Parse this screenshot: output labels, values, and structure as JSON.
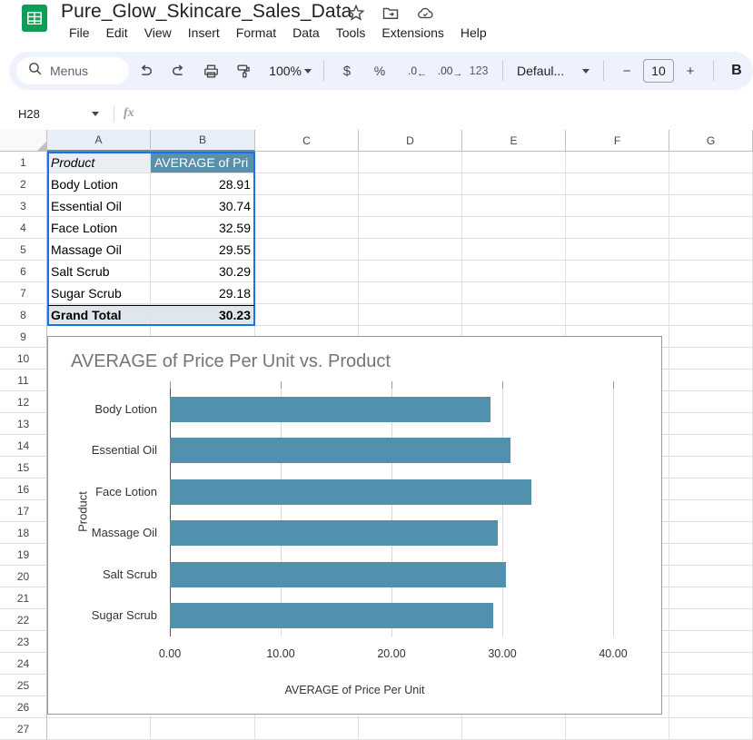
{
  "app": {
    "logo_icon": "sheets-logo-icon",
    "doc_title": "Pure_Glow_Skincare_Sales_Data",
    "title_icons": [
      {
        "name": "star-icon",
        "label": "Star"
      },
      {
        "name": "move-to-folder-icon",
        "label": "Move"
      },
      {
        "name": "cloud-saved-icon",
        "label": "Saved to Drive"
      }
    ],
    "menus": [
      "File",
      "Edit",
      "View",
      "Insert",
      "Format",
      "Data",
      "Tools",
      "Extensions",
      "Help"
    ]
  },
  "toolbar": {
    "search_icon": "search-icon",
    "search_label": "Menus",
    "undo_icon": "undo-icon",
    "redo_icon": "redo-icon",
    "print_icon": "print-icon",
    "paint_format_icon": "paint-format-icon",
    "zoom_value": "100%",
    "currency_label": "$",
    "percent_label": "%",
    "decrease_decimal_label": ".0",
    "increase_decimal_label": ".00",
    "more_formats_label": "123",
    "font_name": "Defaul...",
    "font_size": "10",
    "minus_label": "−",
    "plus_label": "+",
    "bold_label": "B"
  },
  "formula_bar": {
    "name_box": "H28",
    "fx_label": "fx",
    "formula_value": ""
  },
  "grid": {
    "columns": [
      "A",
      "B",
      "C",
      "D",
      "E",
      "F",
      "G"
    ],
    "rows": [
      1,
      2,
      3,
      4,
      5,
      6,
      7,
      8,
      9,
      10,
      11,
      12,
      13,
      14,
      15,
      16,
      17,
      18,
      19,
      20,
      21,
      22,
      23,
      24,
      25,
      26,
      27
    ],
    "data": [
      {
        "a": "Product",
        "b": "AVERAGE of Pri"
      },
      {
        "a": "Body Lotion",
        "b": "28.91"
      },
      {
        "a": "Essential Oil",
        "b": "30.74"
      },
      {
        "a": "Face Lotion",
        "b": "32.59"
      },
      {
        "a": "Massage Oil",
        "b": "29.55"
      },
      {
        "a": "Salt Scrub",
        "b": "30.29"
      },
      {
        "a": "Sugar Scrub",
        "b": "29.18"
      },
      {
        "a": "Grand Total",
        "b": "30.23"
      }
    ],
    "selection_color": "#1a73e8",
    "header_fill": "#5b90ab",
    "total_fill": "#dfe7ed"
  },
  "chart_data": {
    "type": "bar",
    "orientation": "horizontal",
    "title": "AVERAGE of Price Per Unit vs. Product",
    "xlabel": "AVERAGE of Price Per Unit",
    "ylabel": "Product",
    "categories": [
      "Body Lotion",
      "Essential Oil",
      "Face Lotion",
      "Massage Oil",
      "Salt Scrub",
      "Sugar Scrub"
    ],
    "values": [
      28.91,
      30.74,
      32.59,
      29.55,
      30.29,
      29.18
    ],
    "xlim": [
      0,
      40
    ],
    "xticks": [
      "0.00",
      "10.00",
      "20.00",
      "30.00",
      "40.00"
    ],
    "xtick_values": [
      0,
      10,
      20,
      30,
      40
    ],
    "bar_color": "#5291ae",
    "grid": true,
    "legend": false
  }
}
